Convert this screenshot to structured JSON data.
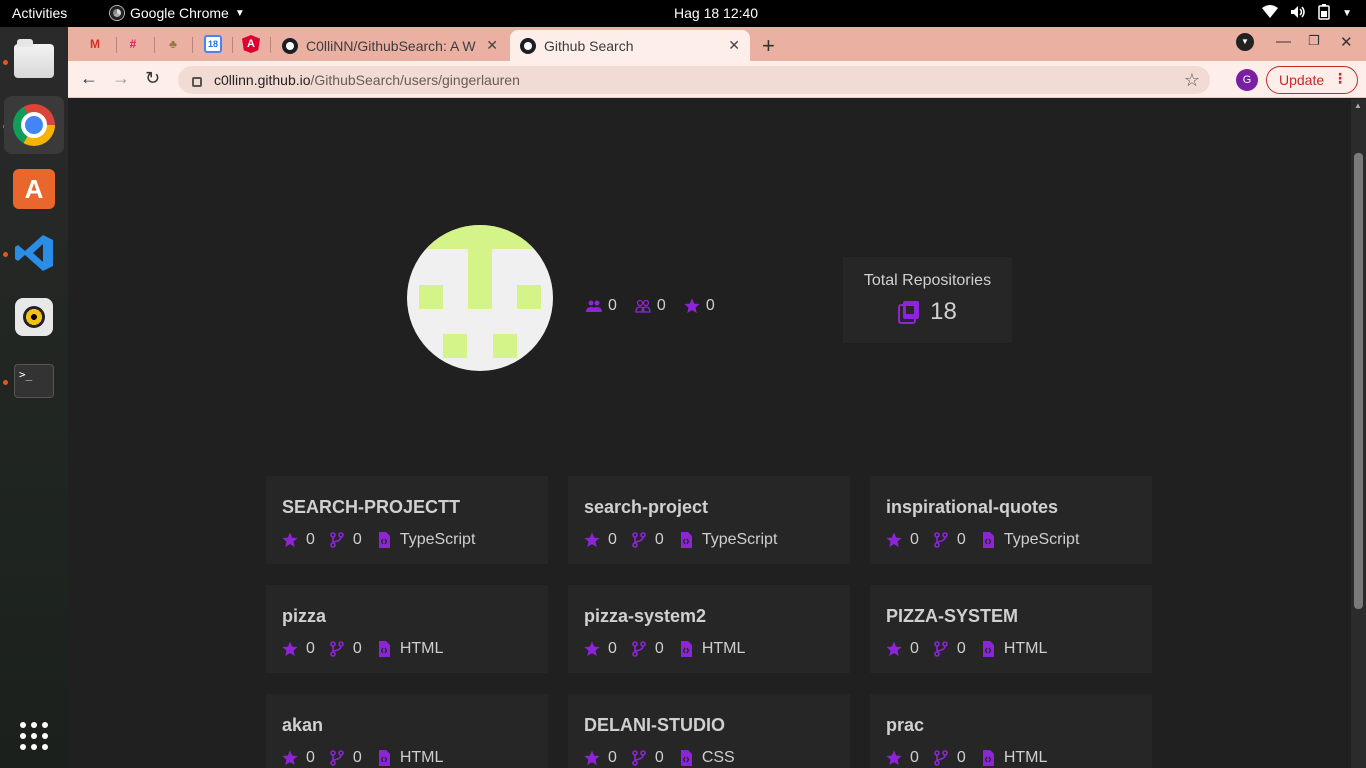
{
  "topbar": {
    "activities": "Activities",
    "app_name": "Google Chrome",
    "clock": "Hag 18  12:40"
  },
  "dock": {
    "items": [
      "files-icon",
      "chrome-icon",
      "app-store-icon",
      "vscode-icon",
      "rhythmbox-icon",
      "terminal-icon",
      "show-apps-icon"
    ]
  },
  "browser": {
    "tabs": [
      {
        "label": "C0lliNN/GithubSearch: A W"
      },
      {
        "label": "Github Search"
      }
    ],
    "url_host": "c0llinn.github.io",
    "url_path": "/GithubSearch/users/gingerlauren",
    "profile_initial": "G",
    "update_label": "Update"
  },
  "profile": {
    "followers": "0",
    "following": "0",
    "stars": "0",
    "total_label": "Total Repositories",
    "total_value": "18"
  },
  "repos": [
    {
      "name": "SEARCH-PROJECTT",
      "stars": "0",
      "forks": "0",
      "language": "TypeScript"
    },
    {
      "name": "search-project",
      "stars": "0",
      "forks": "0",
      "language": "TypeScript"
    },
    {
      "name": "inspirational-quotes",
      "stars": "0",
      "forks": "0",
      "language": "TypeScript"
    },
    {
      "name": "pizza",
      "stars": "0",
      "forks": "0",
      "language": "HTML"
    },
    {
      "name": "pizza-system2",
      "stars": "0",
      "forks": "0",
      "language": "HTML"
    },
    {
      "name": "PIZZA-SYSTEM",
      "stars": "0",
      "forks": "0",
      "language": "HTML"
    },
    {
      "name": "akan",
      "stars": "0",
      "forks": "0",
      "language": "HTML"
    },
    {
      "name": "DELANI-STUDIO",
      "stars": "0",
      "forks": "0",
      "language": "CSS"
    },
    {
      "name": "prac",
      "stars": "0",
      "forks": "0",
      "language": "HTML"
    }
  ],
  "colors": {
    "accent": "#8e24d8",
    "page_bg": "#202020",
    "card_bg": "#262626",
    "tabstrip": "#eab1a3"
  }
}
